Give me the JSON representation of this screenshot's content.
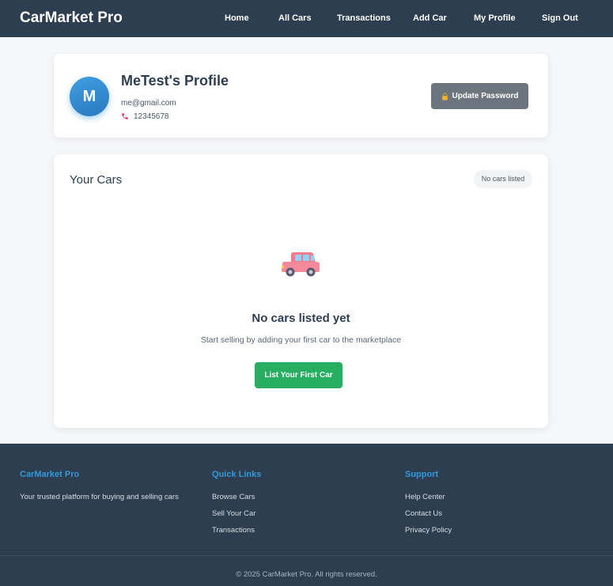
{
  "navbar": {
    "brand": "CarMarket Pro",
    "links": [
      "Home",
      "All Cars",
      "Transactions",
      "Add Car",
      "My Profile",
      "Sign Out"
    ]
  },
  "profile": {
    "avatar_initial": "M",
    "name": "MeTest's Profile",
    "email": "me@gmail.com",
    "phone": "12345678",
    "phone_icon": "phone-icon",
    "update_password_icon": "lock-icon",
    "update_password_label": "Update Password"
  },
  "cars": {
    "title": "Your Cars",
    "count_badge": "No cars listed",
    "empty_icon": "car-icon",
    "empty_title": "No cars listed yet",
    "empty_description": "Start selling by adding your first car to the marketplace",
    "cta_label": "List Your First Car"
  },
  "footer": {
    "about": {
      "heading": "CarMarket Pro",
      "text": "Your trusted platform for buying and selling cars"
    },
    "quick_links": {
      "heading": "Quick Links",
      "links": [
        "Browse Cars",
        "Sell Your Car",
        "Transactions"
      ]
    },
    "support": {
      "heading": "Support",
      "links": [
        "Help Center",
        "Contact Us",
        "Privacy Policy"
      ]
    },
    "copyright": "© 2025 CarMarket Pro. All rights reserved."
  },
  "colors": {
    "navbar_bg": "#2d3e50",
    "accent_blue": "#3498db",
    "success_green": "#27ae60",
    "secondary_gray": "#6c757d"
  }
}
